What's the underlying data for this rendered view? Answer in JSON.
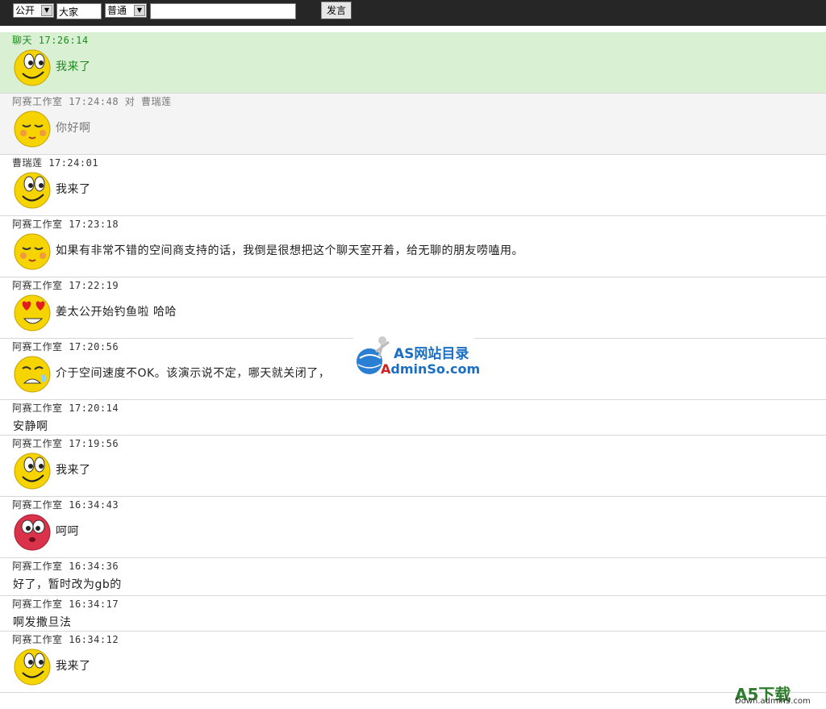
{
  "toolbar": {
    "visibility_select": "公开",
    "target_select": "大家",
    "mode_select": "普通",
    "message_input_value": "",
    "send_label": "发言"
  },
  "messages": [
    {
      "name": "聊天",
      "time": "17:26:14",
      "to_word": "",
      "to": "",
      "text": "我来了",
      "face": "smile"
    },
    {
      "name": "阿赛工作室",
      "time": "17:24:48",
      "to_word": "对",
      "to": "曹瑞莲",
      "text": "你好啊",
      "face": "shy"
    },
    {
      "name": "曹瑞莲",
      "time": "17:24:01",
      "to_word": "",
      "to": "",
      "text": "我来了",
      "face": "smile"
    },
    {
      "name": "阿赛工作室",
      "time": "17:23:18",
      "to_word": "",
      "to": "",
      "text": "如果有非常不错的空间商支持的话，我倒是很想把这个聊天室开着，给无聊的朋友唠嗑用。",
      "face": "shy"
    },
    {
      "name": "阿赛工作室",
      "time": "17:22:19",
      "to_word": "",
      "to": "",
      "text": "姜太公开始钓鱼啦 哈哈",
      "face": "love"
    },
    {
      "name": "阿赛工作室",
      "time": "17:20:56",
      "to_word": "",
      "to": "",
      "text": "介于空间速度不OK。该演示说不定，哪天就关闭了，",
      "face": "cry"
    },
    {
      "name": "阿赛工作室",
      "time": "17:20:14",
      "to_word": "",
      "to": "",
      "text": "安静啊",
      "face": ""
    },
    {
      "name": "阿赛工作室",
      "time": "17:19:56",
      "to_word": "",
      "to": "",
      "text": "我来了",
      "face": "smile"
    },
    {
      "name": "阿赛工作室",
      "time": "16:34:43",
      "to_word": "",
      "to": "",
      "text": "呵呵",
      "face": "red"
    },
    {
      "name": "阿赛工作室",
      "time": "16:34:36",
      "to_word": "",
      "to": "",
      "text": "好了，暂时改为gb的",
      "face": ""
    },
    {
      "name": "阿赛工作室",
      "time": "16:34:17",
      "to_word": "",
      "to": "",
      "text": "啊发撒旦法",
      "face": ""
    },
    {
      "name": "阿赛工作室",
      "time": "16:34:12",
      "to_word": "",
      "to": "",
      "text": "我来了",
      "face": "smile"
    }
  ],
  "watermarks": {
    "site_title": "AS网站目录",
    "site_url_prefix": "A",
    "site_url_rest": "dminSo.com",
    "corner_logo": "A5下载",
    "corner_url": "Down.admin5.com"
  },
  "colors": {
    "toolbar_bg": "#262626",
    "highlight_row": "#d9f0d3",
    "highlight_text": "#1f8a1f",
    "emoji_yellow": "#f5d400",
    "watermark_blue": "#1a6fc4"
  }
}
